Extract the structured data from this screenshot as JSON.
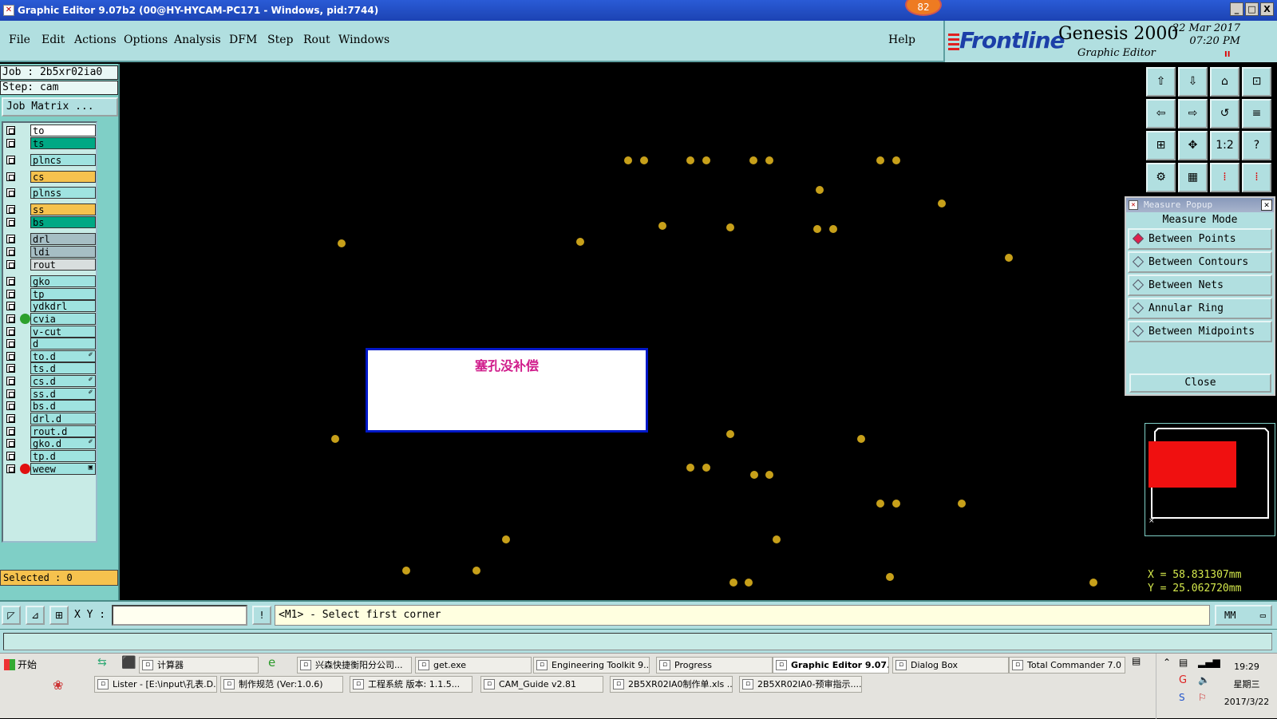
{
  "window": {
    "title": "Graphic Editor 9.07b2 (00@HY-HYCAM-PC171 - Windows, pid:7744)",
    "badge": "82",
    "controls": [
      "_",
      "□",
      "X"
    ]
  },
  "menu": {
    "items": [
      "File",
      "Edit",
      "Actions",
      "Options",
      "Analysis",
      "DFM",
      "Step",
      "Rout",
      "Windows"
    ],
    "help": "Help"
  },
  "brand": {
    "logo": "Frontline",
    "product": "Genesis 2000",
    "subtitle": "Graphic Editor",
    "date": "22 Mar 2017",
    "time": "07:20 PM",
    "record_marker": "II"
  },
  "left_panel": {
    "job": "Job : 2b5xr02ia0",
    "step": "Step: cam",
    "job_matrix_label": "Job Matrix ...",
    "selected": "Selected : 0",
    "layers": [
      {
        "name": "to",
        "color": "#ffffff",
        "dot": "",
        "mark": ""
      },
      {
        "name": "ts",
        "color": "#00a884",
        "dot": "",
        "mark": ""
      },
      {
        "name": "plncs",
        "color": "#9fe3e0",
        "dot": "",
        "mark": ""
      },
      {
        "name": "cs",
        "color": "#f6c24e",
        "dot": "",
        "mark": ""
      },
      {
        "name": "plnss",
        "color": "#9fe3e0",
        "dot": "",
        "mark": ""
      },
      {
        "name": "ss",
        "color": "#f6c24e",
        "dot": "",
        "mark": ""
      },
      {
        "name": "bs",
        "color": "#00a884",
        "dot": "",
        "mark": ""
      },
      {
        "name": "drl",
        "color": "#a6bec4",
        "dot": "",
        "mark": ""
      },
      {
        "name": "ldi",
        "color": "#a6bec4",
        "dot": "",
        "mark": ""
      },
      {
        "name": "rout",
        "color": "#d8dede",
        "dot": "",
        "mark": ""
      },
      {
        "name": "gko",
        "color": "#9fe3e0",
        "dot": "",
        "mark": ""
      },
      {
        "name": "tp",
        "color": "#9fe3e0",
        "dot": "",
        "mark": ""
      },
      {
        "name": "ydkdrl",
        "color": "#9fe3e0",
        "dot": "",
        "mark": ""
      },
      {
        "name": "cvia",
        "color": "#9fe3e0",
        "dot": "#2ca02c",
        "mark": ""
      },
      {
        "name": "v-cut",
        "color": "#9fe3e0",
        "dot": "",
        "mark": ""
      },
      {
        "name": "d",
        "color": "#9fe3e0",
        "dot": "",
        "mark": ""
      },
      {
        "name": "to.d",
        "color": "#9fe3e0",
        "dot": "",
        "mark": "✐"
      },
      {
        "name": "ts.d",
        "color": "#9fe3e0",
        "dot": "",
        "mark": ""
      },
      {
        "name": "cs.d",
        "color": "#9fe3e0",
        "dot": "",
        "mark": "✐"
      },
      {
        "name": "ss.d",
        "color": "#9fe3e0",
        "dot": "",
        "mark": "✐"
      },
      {
        "name": "bs.d",
        "color": "#9fe3e0",
        "dot": "",
        "mark": ""
      },
      {
        "name": "drl.d",
        "color": "#9fe3e0",
        "dot": "",
        "mark": ""
      },
      {
        "name": "rout.d",
        "color": "#9fe3e0",
        "dot": "",
        "mark": ""
      },
      {
        "name": "gko.d",
        "color": "#9fe3e0",
        "dot": "",
        "mark": "✐"
      },
      {
        "name": "tp.d",
        "color": "#9fe3e0",
        "dot": "",
        "mark": ""
      },
      {
        "name": "weew",
        "color": "#9fe3e0",
        "dot": "#e01010",
        "mark": "▣"
      }
    ]
  },
  "canvas": {
    "pad_color": "#c7a01a",
    "message": "塞孔没补偿"
  },
  "toolbar_icons": [
    "zoom-home-icon",
    "zoom-step-icon",
    "zoom-home-house-icon",
    "zoom-fit-icon",
    "pan-left-icon",
    "pan-right-icon",
    "zoom-window-icon",
    "redraw-icon",
    "zoom-all-icon",
    "center-icon",
    "one-to-one-icon",
    "help-icon",
    "snap-icon",
    "grid-icon",
    "layer-compare-icon",
    "net-compare-icon"
  ],
  "toolbar_glyphs": [
    "⇧",
    "⇩",
    "⌂",
    "⊡",
    "⇦",
    "⇨",
    "↺",
    "≡",
    "⊞",
    "✥",
    "1:2",
    "?",
    "⚙",
    "▦",
    "⁞",
    "⁞"
  ],
  "measure": {
    "title": "Measure Popup",
    "mode_label": "Measure Mode",
    "options": [
      "Between Points",
      "Between Contours",
      "Between Nets",
      "Annular Ring",
      "Between Midpoints"
    ],
    "close": "Close"
  },
  "coords": {
    "x": "X = 58.831307mm",
    "y": "Y = 25.062720mm"
  },
  "command": {
    "xy_label": "X Y :",
    "xy_value": "",
    "prompt": "<M1> - Select first corner",
    "units": "MM"
  },
  "taskbar": {
    "start": "开始",
    "row1": [
      "计算器",
      "兴森快捷衡阳分公司...",
      "get.exe",
      "Engineering Toolkit 9....",
      "Progress",
      "Graphic Editor 9.07...",
      "Dialog Box",
      "Total Commander 7.0 ..."
    ],
    "row2": [
      "Lister - [E:\\input\\孔表.D...",
      "制作规范 (Ver:1.0.6)",
      "工程系統  版本: 1.1.5...",
      "CAM_Guide v2.81",
      "2B5XR02IA0制作单.xls ...",
      "2B5XR02IA0-预审指示...."
    ],
    "clock_time": "19:29",
    "clock_day": "星期三",
    "clock_date": "2017/3/22"
  }
}
